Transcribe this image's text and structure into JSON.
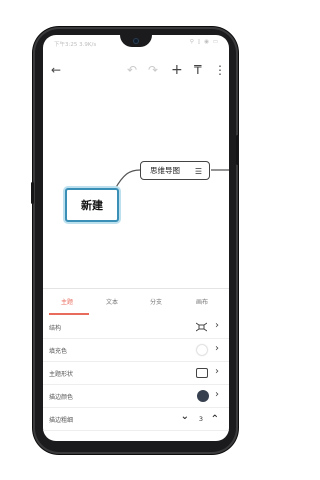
{
  "status_bar": {
    "time": "下午3:25",
    "speed": "3.9K/s",
    "right_icons": "⚲ ▯ ◉ ▭"
  },
  "toolbar": {
    "back_icon": "←",
    "undo_icon": "↶",
    "redo_icon": "↷",
    "add_icon": "+",
    "style_icon": "₸",
    "more_icon": "⋮"
  },
  "canvas": {
    "root_node": "新建",
    "child_node": "思维导图",
    "child_icon": "☰"
  },
  "panel": {
    "tabs": [
      "主题",
      "文本",
      "分支",
      "画布"
    ],
    "active_tab": "主题",
    "rows": [
      {
        "label": "结构",
        "control": "structure-icon"
      },
      {
        "label": "填充色",
        "control": "empty-color"
      },
      {
        "label": "主题形状",
        "control": "shape-rect"
      },
      {
        "label": "描边颜色",
        "control": "dark-color"
      },
      {
        "label": "描边粗细",
        "control": "stepper",
        "value": "3"
      }
    ],
    "chevron": "›",
    "stepper": {
      "down": "⌄",
      "up": "⌃"
    }
  },
  "colors": {
    "accent": "#e86b5c",
    "node_border": "#3a8fb7",
    "stroke_color": "#37404f"
  }
}
